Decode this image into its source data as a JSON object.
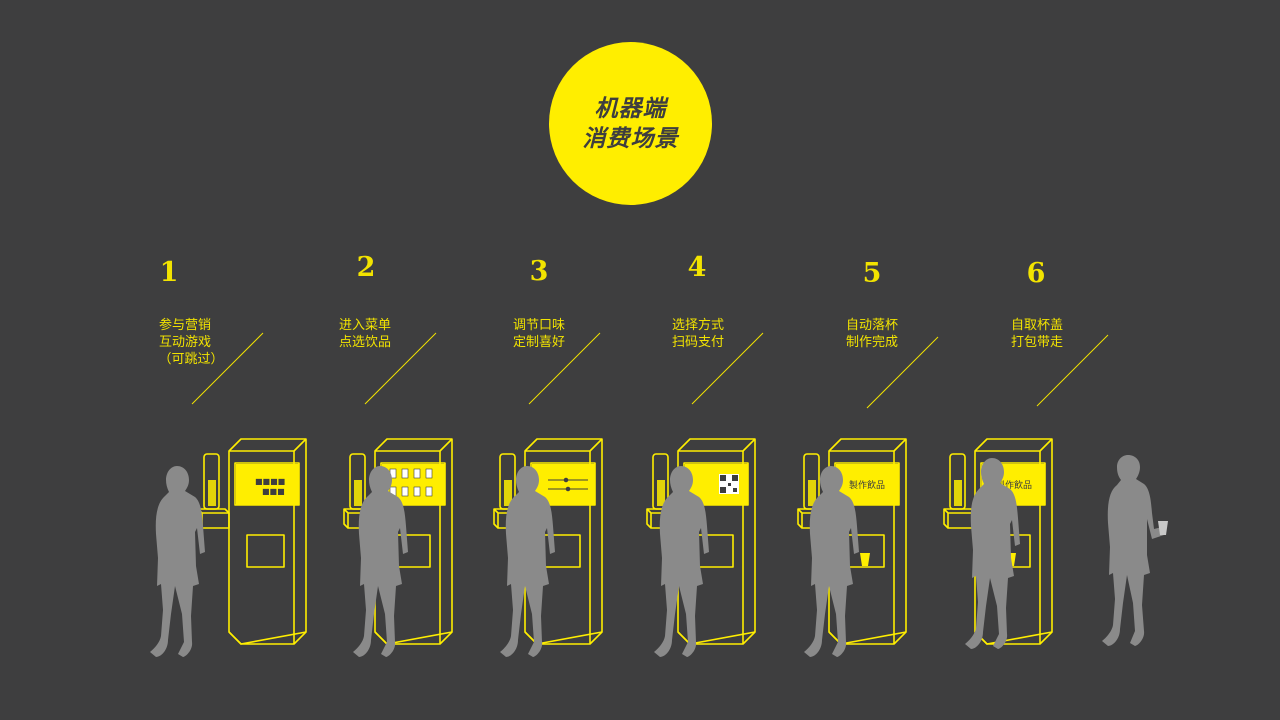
{
  "title": {
    "line1": "机器端",
    "line2": "消费场景"
  },
  "steps": [
    {
      "number": "1",
      "lines": [
        "参与营销",
        "互动游戏",
        "（可跳过）"
      ]
    },
    {
      "number": "2",
      "lines": [
        "进入菜单",
        "点选饮品"
      ]
    },
    {
      "number": "3",
      "lines": [
        "调节口味",
        "定制喜好"
      ]
    },
    {
      "number": "4",
      "lines": [
        "选择方式",
        "扫码支付"
      ]
    },
    {
      "number": "5",
      "lines": [
        "自动落杯",
        "制作完成"
      ]
    },
    {
      "number": "6",
      "lines": [
        "自取杯盖",
        "打包带走"
      ]
    }
  ],
  "screens": {
    "making": "製作飲品"
  },
  "colors": {
    "background": "#3e3e3f",
    "accent": "#ffee00",
    "figure": "#8a8a8a"
  }
}
